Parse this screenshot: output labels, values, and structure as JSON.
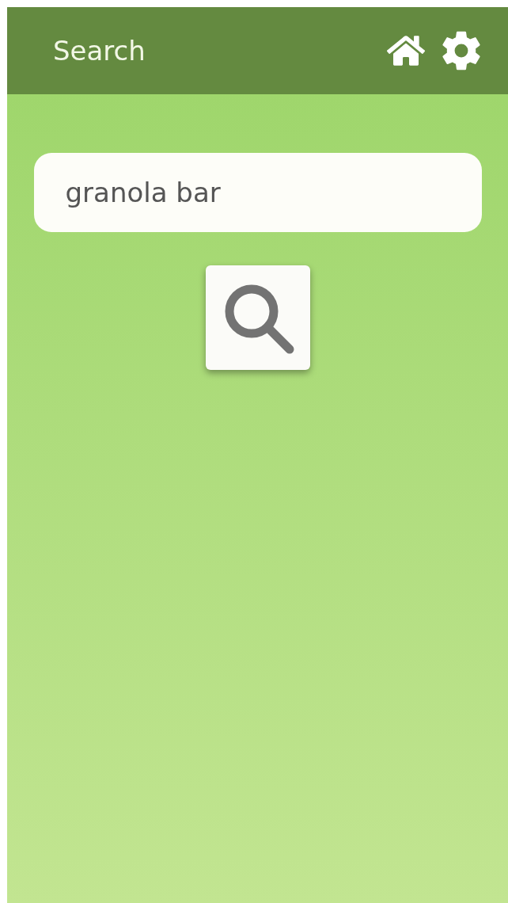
{
  "header": {
    "title": "Search"
  },
  "search": {
    "value": "granola bar"
  }
}
